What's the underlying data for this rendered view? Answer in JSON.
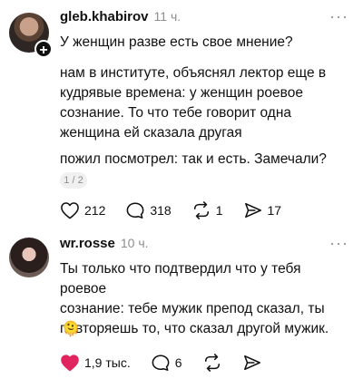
{
  "post1": {
    "username": "gleb.khabirov",
    "time": "11 ч.",
    "more": "···",
    "plus_badge": "+",
    "text1": "У женщин разве есть свое мнение?",
    "text2_lines": [
      "нам в институте, объяснял лектор еще в",
      "кудрявые времена: у женщин роевое",
      "сознание. То что тебе говорит одна",
      "женщина ей сказала другая"
    ],
    "text3": "пожил посмотрел: так и есть. Замечали?",
    "pager": "1 / 2",
    "likes": "212",
    "comments": "318",
    "reposts": "1",
    "shares": "17"
  },
  "post2": {
    "username": "wr.rosse",
    "time": "10 ч.",
    "more": "···",
    "text_lines": [
      "Ты только что подтвердил что у тебя роевое",
      "сознание: тебе мужик препод сказал, ты",
      "повторяешь то, что сказал другой мужик."
    ],
    "emoji": "🫠",
    "likes": "1,9 тыс.",
    "comments": "6"
  },
  "colors": {
    "like_active": "#e0245e",
    "muted": "#8e8e8e"
  },
  "icons": [
    "heart-icon",
    "comment-icon",
    "repost-icon",
    "share-icon"
  ]
}
